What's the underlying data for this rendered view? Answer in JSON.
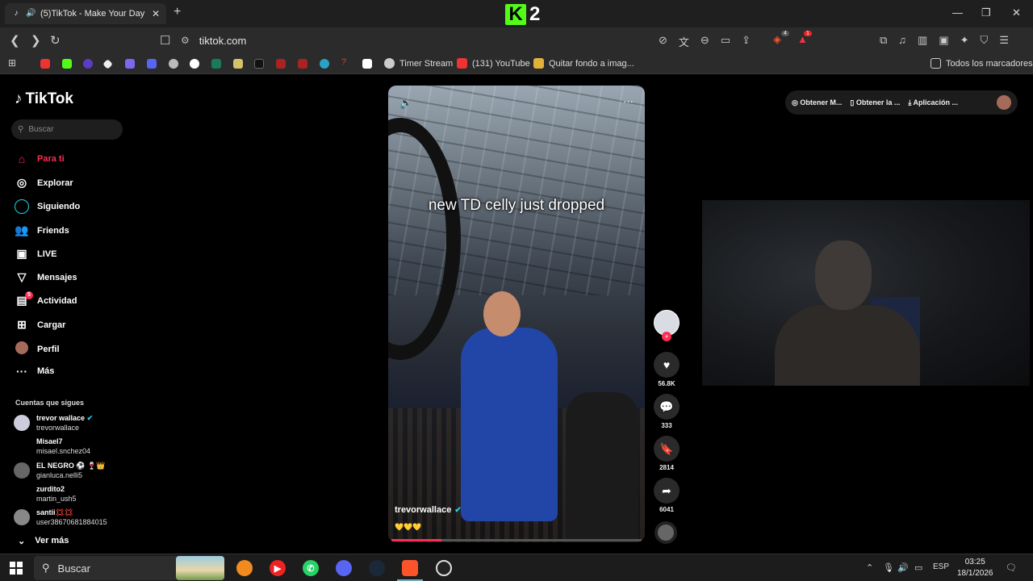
{
  "browser": {
    "tab_title": "(5)TikTok - Make Your Day",
    "tab_close": "✕",
    "new_tab": "+",
    "url": "tiktok.com",
    "win_minimize": "—",
    "win_restore": "❐",
    "win_close": "✕",
    "overlay_logo_number": "2",
    "overlay_logo_letter": "K",
    "brave_badge": "4",
    "alert_badge": "1",
    "bookmarks": [
      {
        "label": "Timer Stream"
      },
      {
        "label": "(131) YouTube"
      },
      {
        "label": "Quitar fondo a imag..."
      }
    ],
    "all_bookmarks_label": "Todos los marcadores"
  },
  "tiktok": {
    "logo": "TikTok",
    "search_placeholder": "Buscar",
    "nav": [
      {
        "label": "Para ti",
        "icon": "home-icon"
      },
      {
        "label": "Explorar",
        "icon": "compass-icon"
      },
      {
        "label": "Siguiendo",
        "icon": "following-icon"
      },
      {
        "label": "Friends",
        "icon": "friends-icon"
      },
      {
        "label": "LIVE",
        "icon": "live-icon"
      },
      {
        "label": "Mensajes",
        "icon": "messages-icon"
      },
      {
        "label": "Actividad",
        "icon": "activity-icon",
        "badge": "5"
      },
      {
        "label": "Cargar",
        "icon": "upload-icon"
      },
      {
        "label": "Perfil",
        "icon": "profile-icon"
      },
      {
        "label": "Más",
        "icon": "more-icon"
      }
    ],
    "following_title": "Cuentas que sigues",
    "following": [
      {
        "name": "trevor wallace",
        "handle": "trevorwallace"
      },
      {
        "name": "Misael7",
        "handle": "misael.snchez04"
      },
      {
        "name": "EL NEGRO ⚽ 🍷👑",
        "handle": "gianluca.nelli5"
      },
      {
        "name": "zurdito2",
        "handle": "martin_ush5"
      },
      {
        "name": "santii💢💢",
        "handle": "user38670681884015"
      }
    ],
    "see_more": "Ver más",
    "video": {
      "caption": "new TD celly just dropped",
      "author": "trevorwallace",
      "emojis": "💛💛💛",
      "progress": 0.2
    },
    "actions": {
      "likes": "56.8K",
      "comments": "333",
      "saves": "2814",
      "shares": "6041"
    },
    "top_actions": [
      {
        "label": "Obtener M..."
      },
      {
        "label": "Obtener la ..."
      },
      {
        "label": "Aplicación ..."
      }
    ]
  },
  "taskbar": {
    "search_label": "Buscar",
    "language": "ESP",
    "time": "03:25",
    "date": "18/1/2026"
  },
  "colors": {
    "accent": "#fe2c55",
    "kick_green": "#53fc18"
  }
}
